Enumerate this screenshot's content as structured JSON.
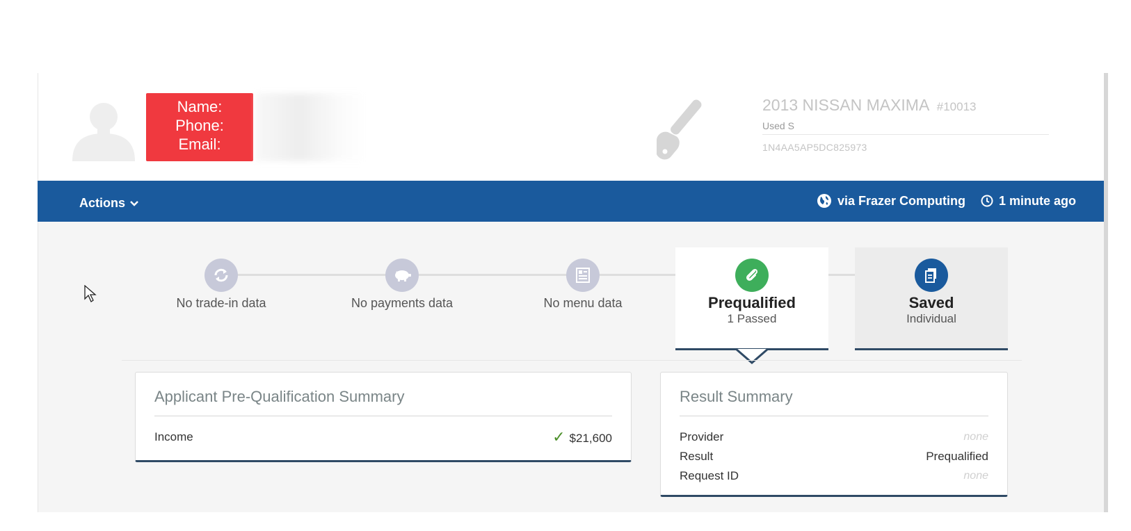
{
  "contact": {
    "name_label": "Name:",
    "phone_label": "Phone:",
    "email_label": "Email:"
  },
  "vehicle": {
    "title": "2013 NISSAN MAXIMA",
    "stock": "#10013",
    "condition": "Used S",
    "vin": "1N4AA5AP5DC825973"
  },
  "toolbar": {
    "actions_label": "Actions",
    "source_label": "via Frazer Computing",
    "time_label": "1 minute ago"
  },
  "steps": [
    {
      "label": "No trade-in data",
      "icon": "refresh-icon"
    },
    {
      "label": "No payments data",
      "icon": "piggy-bank-icon"
    },
    {
      "label": "No menu data",
      "icon": "menu-list-icon"
    },
    {
      "title": "Prequalified",
      "sub": "1 Passed",
      "icon": "paperclip-icon"
    },
    {
      "title": "Saved",
      "sub": "Individual",
      "icon": "documents-icon"
    }
  ],
  "applicant_summary": {
    "title": "Applicant Pre-Qualification Summary",
    "rows": [
      {
        "label": "Income",
        "value": "$21,600"
      }
    ]
  },
  "result_summary": {
    "title": "Result Summary",
    "rows": [
      {
        "label": "Provider",
        "value": "none"
      },
      {
        "label": "Result",
        "value": "Prequalified"
      },
      {
        "label": "Request ID",
        "value": "none"
      }
    ]
  },
  "colors": {
    "toolbar_bg": "#1a5a9d",
    "contact_badge": "#f0393f",
    "prequalified_green": "#3eae5b",
    "saved_blue": "#1a5a9d",
    "step_inactive": "#c7c9d9"
  }
}
